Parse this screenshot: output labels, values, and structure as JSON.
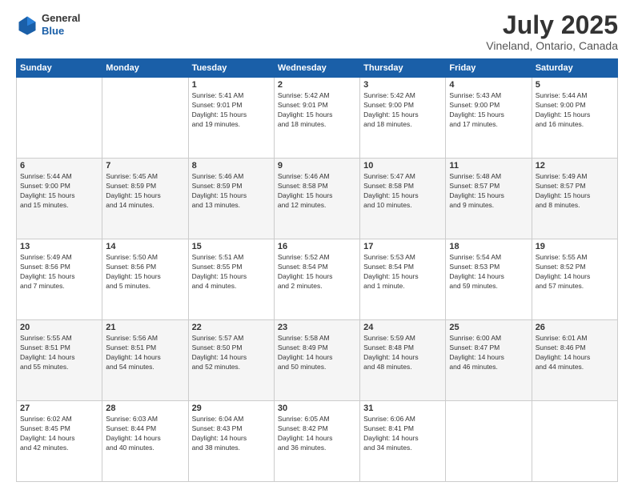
{
  "header": {
    "logo": {
      "general": "General",
      "blue": "Blue"
    },
    "title": "July 2025",
    "location": "Vineland, Ontario, Canada"
  },
  "weekdays": [
    "Sunday",
    "Monday",
    "Tuesday",
    "Wednesday",
    "Thursday",
    "Friday",
    "Saturday"
  ],
  "weeks": [
    [
      {
        "day": "",
        "info": ""
      },
      {
        "day": "",
        "info": ""
      },
      {
        "day": "1",
        "info": "Sunrise: 5:41 AM\nSunset: 9:01 PM\nDaylight: 15 hours\nand 19 minutes."
      },
      {
        "day": "2",
        "info": "Sunrise: 5:42 AM\nSunset: 9:01 PM\nDaylight: 15 hours\nand 18 minutes."
      },
      {
        "day": "3",
        "info": "Sunrise: 5:42 AM\nSunset: 9:00 PM\nDaylight: 15 hours\nand 18 minutes."
      },
      {
        "day": "4",
        "info": "Sunrise: 5:43 AM\nSunset: 9:00 PM\nDaylight: 15 hours\nand 17 minutes."
      },
      {
        "day": "5",
        "info": "Sunrise: 5:44 AM\nSunset: 9:00 PM\nDaylight: 15 hours\nand 16 minutes."
      }
    ],
    [
      {
        "day": "6",
        "info": "Sunrise: 5:44 AM\nSunset: 9:00 PM\nDaylight: 15 hours\nand 15 minutes."
      },
      {
        "day": "7",
        "info": "Sunrise: 5:45 AM\nSunset: 8:59 PM\nDaylight: 15 hours\nand 14 minutes."
      },
      {
        "day": "8",
        "info": "Sunrise: 5:46 AM\nSunset: 8:59 PM\nDaylight: 15 hours\nand 13 minutes."
      },
      {
        "day": "9",
        "info": "Sunrise: 5:46 AM\nSunset: 8:58 PM\nDaylight: 15 hours\nand 12 minutes."
      },
      {
        "day": "10",
        "info": "Sunrise: 5:47 AM\nSunset: 8:58 PM\nDaylight: 15 hours\nand 10 minutes."
      },
      {
        "day": "11",
        "info": "Sunrise: 5:48 AM\nSunset: 8:57 PM\nDaylight: 15 hours\nand 9 minutes."
      },
      {
        "day": "12",
        "info": "Sunrise: 5:49 AM\nSunset: 8:57 PM\nDaylight: 15 hours\nand 8 minutes."
      }
    ],
    [
      {
        "day": "13",
        "info": "Sunrise: 5:49 AM\nSunset: 8:56 PM\nDaylight: 15 hours\nand 7 minutes."
      },
      {
        "day": "14",
        "info": "Sunrise: 5:50 AM\nSunset: 8:56 PM\nDaylight: 15 hours\nand 5 minutes."
      },
      {
        "day": "15",
        "info": "Sunrise: 5:51 AM\nSunset: 8:55 PM\nDaylight: 15 hours\nand 4 minutes."
      },
      {
        "day": "16",
        "info": "Sunrise: 5:52 AM\nSunset: 8:54 PM\nDaylight: 15 hours\nand 2 minutes."
      },
      {
        "day": "17",
        "info": "Sunrise: 5:53 AM\nSunset: 8:54 PM\nDaylight: 15 hours\nand 1 minute."
      },
      {
        "day": "18",
        "info": "Sunrise: 5:54 AM\nSunset: 8:53 PM\nDaylight: 14 hours\nand 59 minutes."
      },
      {
        "day": "19",
        "info": "Sunrise: 5:55 AM\nSunset: 8:52 PM\nDaylight: 14 hours\nand 57 minutes."
      }
    ],
    [
      {
        "day": "20",
        "info": "Sunrise: 5:55 AM\nSunset: 8:51 PM\nDaylight: 14 hours\nand 55 minutes."
      },
      {
        "day": "21",
        "info": "Sunrise: 5:56 AM\nSunset: 8:51 PM\nDaylight: 14 hours\nand 54 minutes."
      },
      {
        "day": "22",
        "info": "Sunrise: 5:57 AM\nSunset: 8:50 PM\nDaylight: 14 hours\nand 52 minutes."
      },
      {
        "day": "23",
        "info": "Sunrise: 5:58 AM\nSunset: 8:49 PM\nDaylight: 14 hours\nand 50 minutes."
      },
      {
        "day": "24",
        "info": "Sunrise: 5:59 AM\nSunset: 8:48 PM\nDaylight: 14 hours\nand 48 minutes."
      },
      {
        "day": "25",
        "info": "Sunrise: 6:00 AM\nSunset: 8:47 PM\nDaylight: 14 hours\nand 46 minutes."
      },
      {
        "day": "26",
        "info": "Sunrise: 6:01 AM\nSunset: 8:46 PM\nDaylight: 14 hours\nand 44 minutes."
      }
    ],
    [
      {
        "day": "27",
        "info": "Sunrise: 6:02 AM\nSunset: 8:45 PM\nDaylight: 14 hours\nand 42 minutes."
      },
      {
        "day": "28",
        "info": "Sunrise: 6:03 AM\nSunset: 8:44 PM\nDaylight: 14 hours\nand 40 minutes."
      },
      {
        "day": "29",
        "info": "Sunrise: 6:04 AM\nSunset: 8:43 PM\nDaylight: 14 hours\nand 38 minutes."
      },
      {
        "day": "30",
        "info": "Sunrise: 6:05 AM\nSunset: 8:42 PM\nDaylight: 14 hours\nand 36 minutes."
      },
      {
        "day": "31",
        "info": "Sunrise: 6:06 AM\nSunset: 8:41 PM\nDaylight: 14 hours\nand 34 minutes."
      },
      {
        "day": "",
        "info": ""
      },
      {
        "day": "",
        "info": ""
      }
    ]
  ]
}
